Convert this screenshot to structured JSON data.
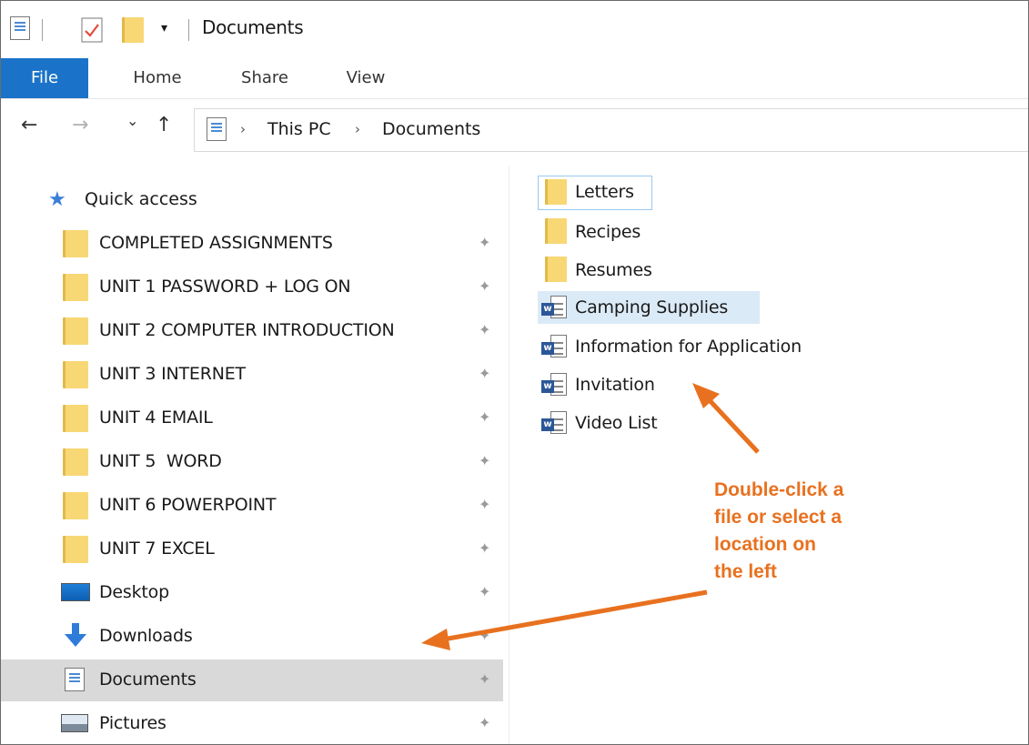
{
  "window": {
    "title": "Documents",
    "quick_access_dropdown": "▾"
  },
  "ribbon": {
    "tabs": [
      "File",
      "Home",
      "Share",
      "View"
    ]
  },
  "address": {
    "crumbs": [
      "This PC",
      "Documents"
    ],
    "back": "←",
    "forward": "→",
    "recent": "⌄",
    "up": "↑",
    "separator": "›"
  },
  "nav_pane": {
    "quick_access_label": "Quick access",
    "items": [
      {
        "label": "COMPLETED ASSIGNMENTS",
        "icon": "folder-icon",
        "pinned": true
      },
      {
        "label": "UNIT 1 PASSWORD + LOG ON",
        "icon": "folder-icon",
        "pinned": true
      },
      {
        "label": "UNIT 2 COMPUTER INTRODUCTION",
        "icon": "folder-icon",
        "pinned": true
      },
      {
        "label": "UNIT 3 INTERNET",
        "icon": "folder-icon",
        "pinned": true
      },
      {
        "label": "UNIT 4 EMAIL",
        "icon": "folder-icon",
        "pinned": true
      },
      {
        "label": "UNIT 5  WORD",
        "icon": "folder-icon",
        "pinned": true
      },
      {
        "label": "UNIT 6 POWERPOINT",
        "icon": "folder-icon",
        "pinned": true
      },
      {
        "label": "UNIT 7 EXCEL",
        "icon": "folder-icon",
        "pinned": true
      },
      {
        "label": "Desktop",
        "icon": "desktop-icon",
        "pinned": true
      },
      {
        "label": "Downloads",
        "icon": "download-icon",
        "pinned": true
      },
      {
        "label": "Documents",
        "icon": "documents-icon",
        "pinned": true,
        "selected": true
      },
      {
        "label": "Pictures",
        "icon": "pictures-icon",
        "pinned": true
      }
    ],
    "pin_glyph": "📌"
  },
  "content": {
    "items": [
      {
        "label": "Letters",
        "type": "folder",
        "state": "focused"
      },
      {
        "label": "Recipes",
        "type": "folder"
      },
      {
        "label": "Resumes",
        "type": "folder"
      },
      {
        "label": "Camping Supplies",
        "type": "word-document",
        "state": "hovered"
      },
      {
        "label": "Information for Application",
        "type": "word-document"
      },
      {
        "label": "Invitation",
        "type": "word-document"
      },
      {
        "label": "Video List",
        "type": "word-document"
      }
    ]
  },
  "annotation": {
    "lines": [
      "Double-click a",
      "file or select a",
      "location on",
      "the left"
    ],
    "color": "#e8711f"
  },
  "colors": {
    "file_tab": "#1a73c8",
    "selected_row": "#d9d9d9",
    "hover_row": "#dbeaf7",
    "folder": "#f8d775"
  }
}
